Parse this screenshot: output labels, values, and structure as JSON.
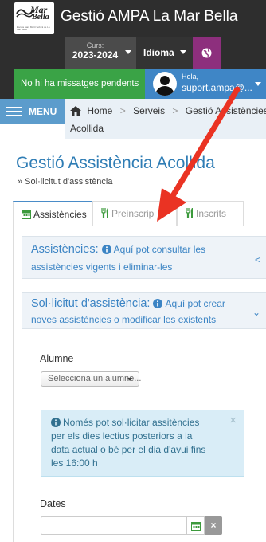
{
  "header": {
    "logo": {
      "line1": "Mar",
      "line2": "Bella",
      "fine_print": "Escola Sant Martí Sobirà de La Mar Bella"
    },
    "title": "Gestió AMPA La Mar Bella"
  },
  "toolbar": {
    "curs_label": "Curs:",
    "curs_value": "2023-2024",
    "idioma_label": "Idioma",
    "globe_icon": "globe-icon"
  },
  "status": {
    "messages": "No hi ha missatges pendents",
    "greeting": "Hola,",
    "user": "suport.ampa@..."
  },
  "nav": {
    "menu_label": "MENU",
    "breadcrumb": [
      "Home",
      "Serveis",
      "Gestió Assistències"
    ],
    "breadcrumb_cont": "Acollida"
  },
  "page": {
    "title": "Gestió Assistència Acollida",
    "subtitle": "» Sol·licitut d'assistència"
  },
  "tabs": [
    {
      "label": "Assistències",
      "icon": "calendar-icon"
    },
    {
      "label": "Preinscrip",
      "icon": "cutlery-icon"
    },
    {
      "label": "Inscrits",
      "icon": "cutlery-icon"
    }
  ],
  "panels": {
    "assistencies": {
      "title": "Assistències:",
      "desc_line1": "Aquí pot consultar les",
      "desc_line2": "assistències vigents i eliminar-les",
      "chevron": "<"
    },
    "solicitud": {
      "title": "Sol·licitut d'assistència:",
      "desc_line1": "Aquí pot crear",
      "desc_line2": "noves assistències o modificar les existents",
      "chevron": "⌄"
    }
  },
  "form": {
    "alumne_label": "Alumne",
    "alumne_placeholder": "Selecciona un alumne...",
    "alert_lines": [
      "Només pot sol·licitar assitències",
      "per els dies lectius posteriors a la",
      "data actual o bé per el dia d'avui fins",
      "les 16:00 h"
    ],
    "alert_close": "×",
    "dates_label": "Dates",
    "dates_value": "",
    "clear_label": "×"
  },
  "colors": {
    "dark": "#2e2e2e",
    "green": "#3aa346",
    "blue": "#3f86c6",
    "purple": "#8d2f7d",
    "accent_text": "#3b84c4",
    "arrow": "#ea3323"
  }
}
